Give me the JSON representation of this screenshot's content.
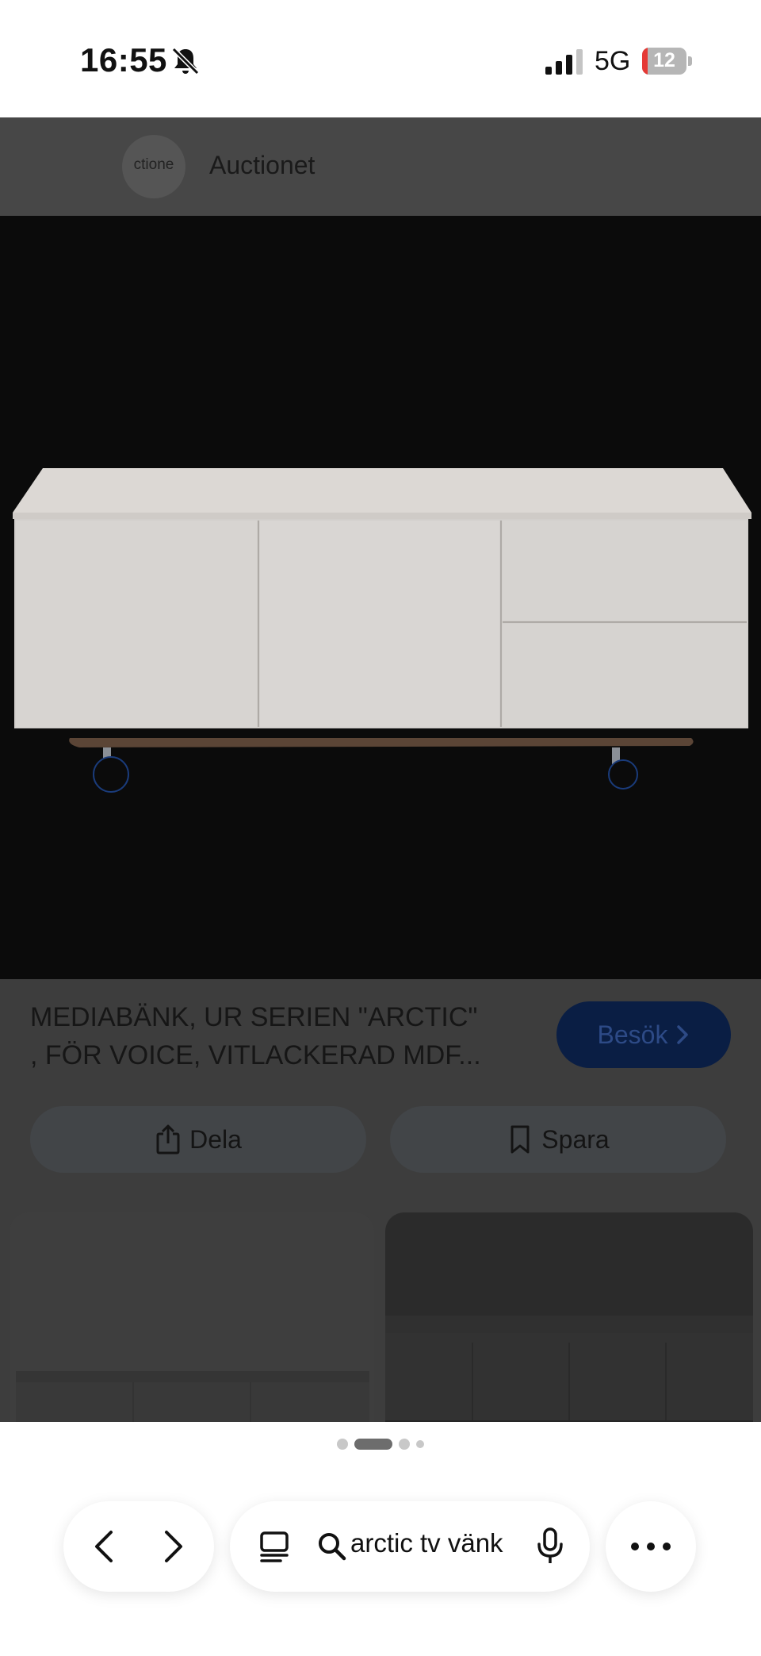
{
  "status_bar": {
    "time": "16:55",
    "network": "5G",
    "battery_level": "12",
    "icons": [
      "bell-slash-icon",
      "signal-icon",
      "battery-icon"
    ]
  },
  "site": {
    "logo_text": "ctione",
    "name": "Auctionet"
  },
  "result": {
    "title_line1": "MEDIABÄNK, UR SERIEN \"ARCTIC\"",
    "title_line2": ", FÖR VOICE, VITLACKERAD MDF...",
    "visit_label": "Besök",
    "share_label": "Dela",
    "save_label": "Spara"
  },
  "pager": {
    "pages": 4,
    "active_index": 1
  },
  "toolbar": {
    "search_query": "arctic tv vänk",
    "icons": [
      "back-icon",
      "forward-icon",
      "tabs-icon",
      "search-icon",
      "microphone-icon",
      "more-icon"
    ]
  },
  "colors": {
    "accent_button": "#0a1e44",
    "overlay": "#3d3d3d",
    "battery_low": "#e53935"
  }
}
